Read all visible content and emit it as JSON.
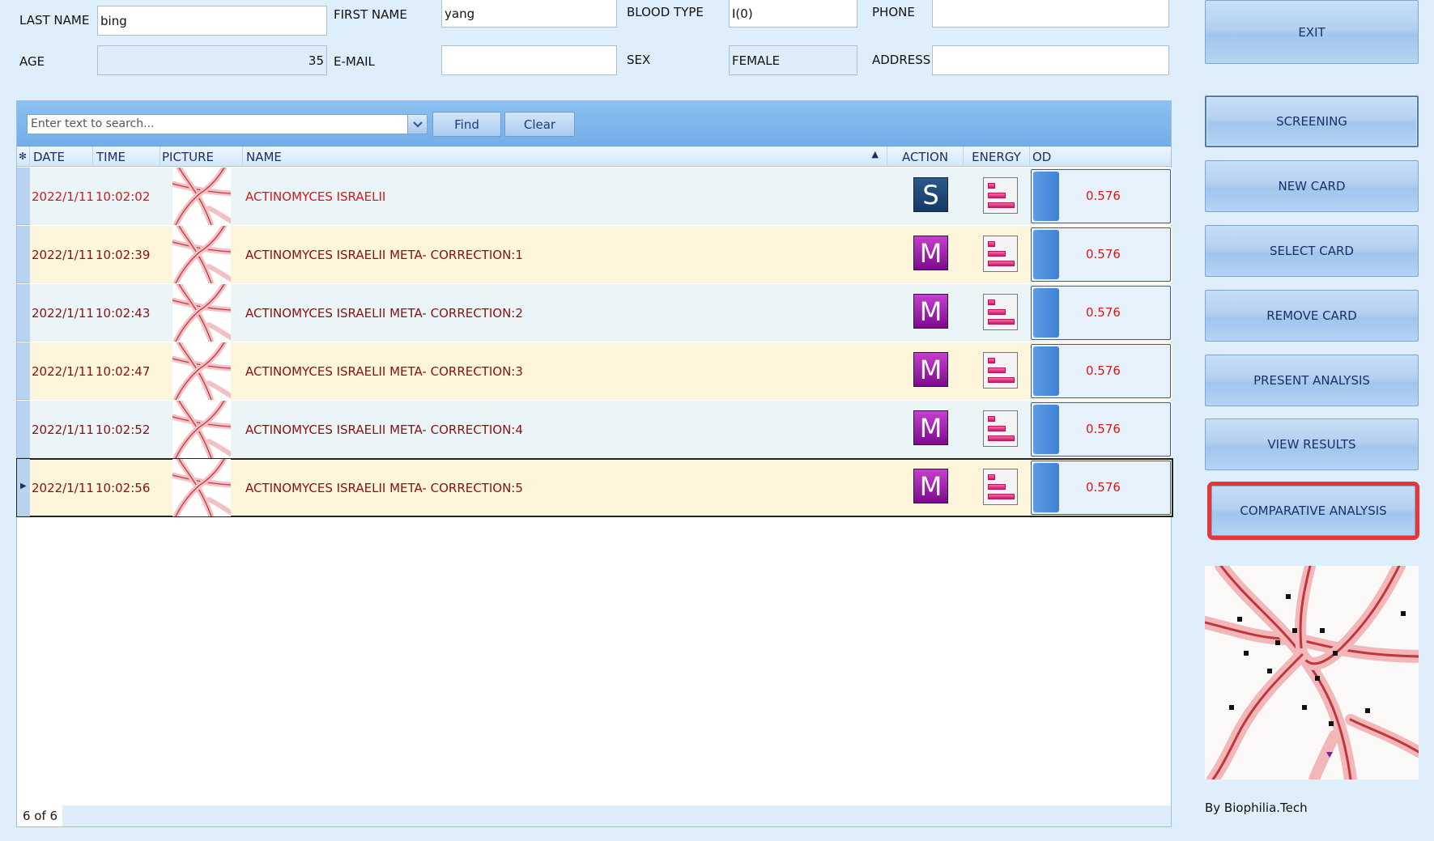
{
  "patient": {
    "last_name_label": "LAST NAME",
    "last_name_value": "bing",
    "first_name_label": "FIRST NAME",
    "first_name_value": "yang",
    "blood_type_label": "BLOOD TYPE",
    "blood_type_value": "I(0)",
    "phone_label": "PHONE",
    "phone_value": "",
    "age_label": "AGE",
    "age_value": "35",
    "email_label": "E-MAIL",
    "email_value": "",
    "sex_label": "SEX",
    "sex_value": "FEMALE",
    "address_label": "ADDRESS",
    "address_value": ""
  },
  "toolbar": {
    "search_placeholder": "Enter text to search...",
    "find_label": "Find",
    "clear_label": "Clear"
  },
  "columns": {
    "date": "DATE",
    "time": "TIME",
    "picture": "PICTURE",
    "name": "NAME",
    "action": "ACTION",
    "energy": "ENERGY",
    "od": "OD"
  },
  "rows": [
    {
      "date": "2022/1/11",
      "time": "10:02:02",
      "name": "ACTINOMYCES  ISRAELII",
      "action": "S",
      "od": "0.576"
    },
    {
      "date": "2022/1/11",
      "time": "10:02:39",
      "name": "ACTINOMYCES  ISRAELII META- CORRECTION:1",
      "action": "M",
      "od": "0.576"
    },
    {
      "date": "2022/1/11",
      "time": "10:02:43",
      "name": "ACTINOMYCES  ISRAELII META- CORRECTION:2",
      "action": "M",
      "od": "0.576"
    },
    {
      "date": "2022/1/11",
      "time": "10:02:47",
      "name": "ACTINOMYCES  ISRAELII META- CORRECTION:3",
      "action": "M",
      "od": "0.576"
    },
    {
      "date": "2022/1/11",
      "time": "10:02:52",
      "name": "ACTINOMYCES  ISRAELII META- CORRECTION:4",
      "action": "M",
      "od": "0.576"
    },
    {
      "date": "2022/1/11",
      "time": "10:02:56",
      "name": "ACTINOMYCES  ISRAELII META- CORRECTION:5",
      "action": "M",
      "od": "0.576"
    }
  ],
  "footer": {
    "count": "6 of 6"
  },
  "sidebar": {
    "exit": "EXIT",
    "screening": "SCREENING",
    "new_card": "NEW CARD",
    "select_card": "SELECT CARD",
    "remove_card": "REMOVE CARD",
    "present_analysis": "PRESENT ANALYSIS",
    "view_results": "VIEW RESULTS",
    "comparative_analysis": "COMPARATIVE ANALYSIS"
  },
  "brand": "By Biophilia.Tech",
  "colors": {
    "accent_highlight": "#e8353a",
    "od_value": "#d11a1a",
    "action_s": "#1f4a7c",
    "action_m": "#a523b4"
  }
}
